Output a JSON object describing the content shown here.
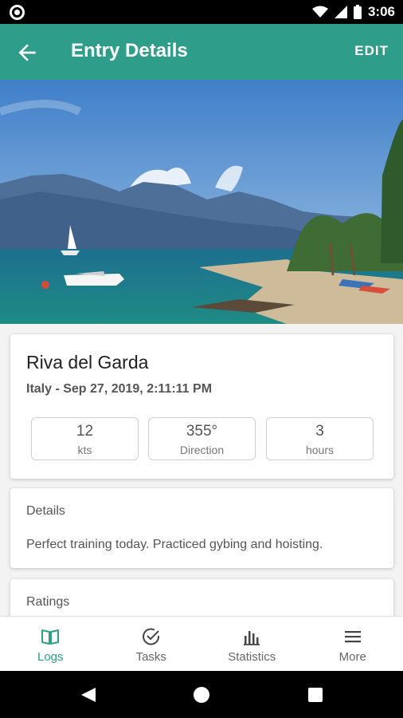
{
  "status_bar": {
    "time": "3:06"
  },
  "app_bar": {
    "title": "Entry Details",
    "edit_label": "EDIT"
  },
  "entry": {
    "place": "Riva del Garda",
    "subtitle": "Italy - Sep 27, 2019, 2:11:11 PM",
    "stats": [
      {
        "value": "12",
        "unit": "kts"
      },
      {
        "value": "355°",
        "unit": "Direction"
      },
      {
        "value": "3",
        "unit": "hours"
      }
    ]
  },
  "details": {
    "label": "Details",
    "text": "Perfect training today. Practiced gybing and hoisting."
  },
  "ratings": {
    "label": "Ratings"
  },
  "nav": [
    {
      "label": "Logs"
    },
    {
      "label": "Tasks"
    },
    {
      "label": "Statistics"
    },
    {
      "label": "More"
    }
  ],
  "colors": {
    "primary": "#2e9e8a"
  }
}
